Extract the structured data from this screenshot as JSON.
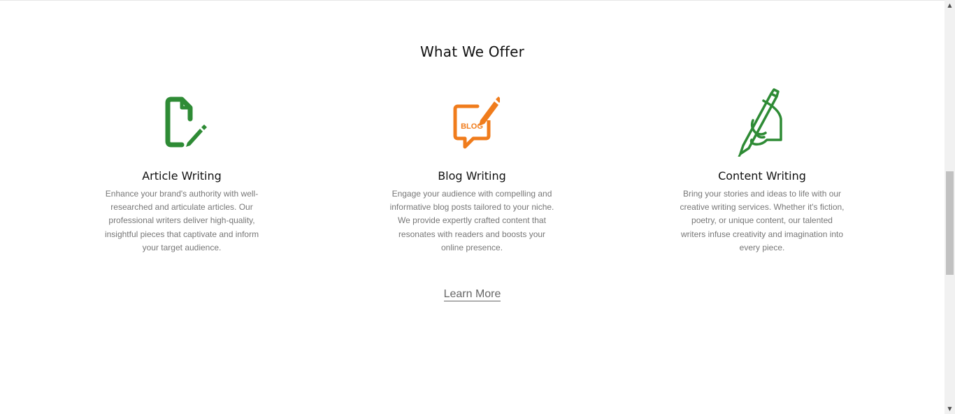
{
  "section": {
    "title": "What We Offer"
  },
  "services": [
    {
      "title": "Article Writing",
      "description": "Enhance your brand's authority with well-researched and articulate articles. Our professional writers deliver high-quality, insightful pieces that captivate and inform your target audience.",
      "icon": "document-pen-icon",
      "color": "#2e8b35"
    },
    {
      "title": "Blog Writing",
      "description": "Engage your audience with compelling and informative blog posts tailored to your niche. We provide expertly crafted content that resonates with readers and boosts your online presence.",
      "icon": "blog-speech-bubble-icon",
      "icon_text": "BLOG",
      "color": "#f07c1c"
    },
    {
      "title": "Content Writing",
      "description": "Bring your stories and ideas to life with our creative writing services. Whether it's fiction, poetry, or unique content, our talented writers infuse creativity and imagination into every piece.",
      "icon": "hand-writing-pen-icon",
      "color": "#2e8b35"
    }
  ],
  "cta": {
    "learn_more_label": "Learn More"
  },
  "scrollbar": {
    "up_arrow": "▲",
    "down_arrow": "▼"
  }
}
